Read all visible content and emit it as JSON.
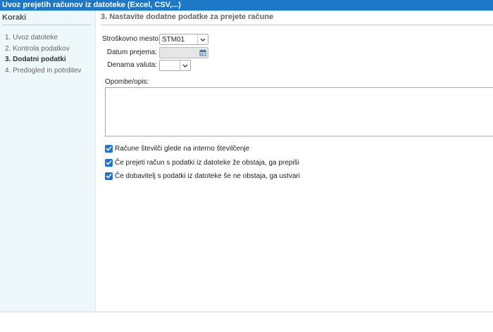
{
  "window": {
    "title": "Uvoz prejetih računov iz datoteke (Excel, CSV,...)"
  },
  "sidebar": {
    "header": "Koraki",
    "steps": [
      {
        "label": "1. Uvoz datoteke",
        "active": false
      },
      {
        "label": "2. Kontrola podatkov",
        "active": false
      },
      {
        "label": "3. Dodatni podatki",
        "active": true
      },
      {
        "label": "4. Predogled in potrditev",
        "active": false
      }
    ]
  },
  "main": {
    "header": "3. Nastavite dodatne podatke za prejete račune",
    "form": {
      "cost_center": {
        "label": "Stroškovno mesto:",
        "value": "STM01",
        "icon": "chevron-down-icon"
      },
      "receipt_date": {
        "label": "Datum prejema:",
        "value": "",
        "icon": "calendar-icon"
      },
      "currency": {
        "label": "Denarna valuta:",
        "value": "",
        "icon": "chevron-down-icon"
      }
    },
    "notes": {
      "label": "Opombe/opis:",
      "value": ""
    },
    "options": [
      {
        "label": "Račune številči glede na interno številčenje",
        "checked": true
      },
      {
        "label": "Če prejeti račun s podatki iz datoteke že obstaja, ga prepiši",
        "checked": true
      },
      {
        "label": "Če dobavitelj s podatki iz datoteke še ne obstaja, ga ustvari",
        "checked": true
      }
    ]
  },
  "colors": {
    "titlebar": "#1e78c8",
    "sidebar_bg": "#eef8fb",
    "checkbox": "#1a73d9"
  }
}
